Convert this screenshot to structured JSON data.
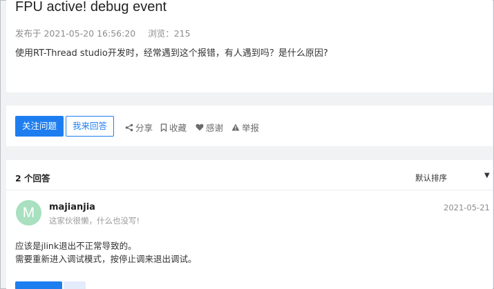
{
  "question": {
    "title": "FPU active! debug event",
    "published": "发布于 2021-05-20 16:56:20",
    "views": "浏览：215",
    "body": "使用RT-Thread studio开发时，经常遇到这个报错，有人遇到吗？是什么原因?"
  },
  "actions": {
    "follow_label": "关注问题",
    "answer_label": "我来回答",
    "share_label": "分享",
    "favorite_label": "收藏",
    "thanks_label": "感谢",
    "report_label": "举报"
  },
  "answers": {
    "count_label": "2 个回答",
    "sort_label": "默认排序",
    "sort_arrow": "▼",
    "items": [
      {
        "avatar_letter": "M",
        "avatar_color": "#a8e0c0",
        "username": "majianjia",
        "signature": "这家伙很懒，什么也没写!",
        "date": "2021-05-21",
        "lines": [
          "应该是jlink退出不正常导致的。",
          "需要重新进入调试模式，按停止调来退出调试。"
        ]
      }
    ]
  },
  "colors": {
    "accent": "#1e7ef0",
    "page_bg": "#f1f2f4"
  },
  "icons": [
    "share-icon",
    "bookmark-icon",
    "heart-icon",
    "warning-icon"
  ]
}
